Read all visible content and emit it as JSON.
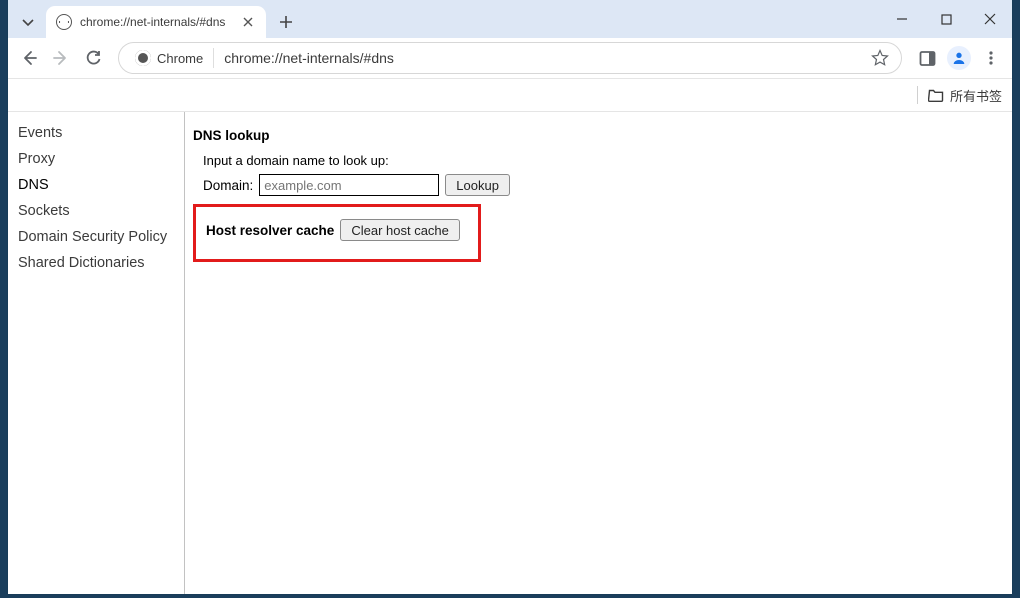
{
  "tab": {
    "title": "chrome://net-internals/#dns"
  },
  "omnibox": {
    "chrome_label": "Chrome",
    "url": "chrome://net-internals/#dns"
  },
  "bookmarks_bar": {
    "all_bookmarks": "所有书签"
  },
  "sidebar": {
    "items": [
      {
        "label": "Events"
      },
      {
        "label": "Proxy"
      },
      {
        "label": "DNS"
      },
      {
        "label": "Sockets"
      },
      {
        "label": "Domain Security Policy"
      },
      {
        "label": "Shared Dictionaries"
      }
    ],
    "active_index": 2
  },
  "main": {
    "dns_lookup_title": "DNS lookup",
    "instruction": "Input a domain name to look up:",
    "domain_label": "Domain:",
    "domain_placeholder": "example.com",
    "domain_value": "",
    "lookup_btn": "Lookup",
    "cache_title": "Host resolver cache",
    "clear_btn": "Clear host cache"
  }
}
